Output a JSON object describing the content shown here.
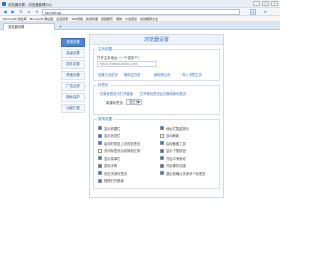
{
  "browser": {
    "window_title": "浏览器设置 - 浏览器管理中心",
    "address": "se:/setup",
    "tab_label": "浏览器设置",
    "bookmarks": [
      "Microsoft 地址库",
      "Microsoft 网址组",
      "必应搜索",
      "360导航",
      "新闻时事",
      "视频娱乐",
      "购物",
      "小说阅读",
      "在线翻译大全"
    ]
  },
  "sidebar": {
    "items": [
      "常规设置",
      "高级设置",
      "插件设置",
      "界面设置",
      "广告过滤",
      "隐私保护",
      "功能扩展"
    ]
  },
  "panel": {
    "title": "浏览器设置",
    "startup": {
      "label": "主页设置",
      "option_text": "打开主页地址（一个或多个）",
      "home_value": "https://www.baidu.com",
      "links": [
        "设置为当前页",
        "使用空白页",
        "使用默认页",
        "导入书签主页"
      ]
    },
    "tabs": {
      "label": "标签页",
      "new_tab_label": "新建标签页",
      "new_tab_value": "空白页",
      "opts": [
        "在新标签页中打开链接",
        "打开新标签页后切换到新标签页"
      ]
    },
    "general": {
      "label": "常用设置",
      "options": [
        {
          "text": "显示收藏栏",
          "checked": true
        },
        {
          "text": "显示状态栏",
          "checked": true
        },
        {
          "text": "启动时恢复上次的标签页",
          "checked": true
        },
        {
          "text": "关闭标签页后切换到左侧",
          "checked": false
        },
        {
          "text": "显示菜单栏",
          "checked": true
        },
        {
          "text": "鼠标手势",
          "checked": true
        },
        {
          "text": "双击关闭标签页",
          "checked": true
        },
        {
          "text": "拖拽打开链接",
          "checked": true
        },
        {
          "text": "地址栏智能提示",
          "checked": true
        },
        {
          "text": "自动刷新",
          "checked": false
        },
        {
          "text": "启用截图工具",
          "checked": true
        },
        {
          "text": "显示下载按钮",
          "checked": true
        },
        {
          "text": "开启平滑滚动",
          "checked": true
        },
        {
          "text": "开启硬件加速",
          "checked": true
        },
        {
          "text": "退出前确认关闭多个标签页",
          "checked": true
        }
      ]
    }
  }
}
